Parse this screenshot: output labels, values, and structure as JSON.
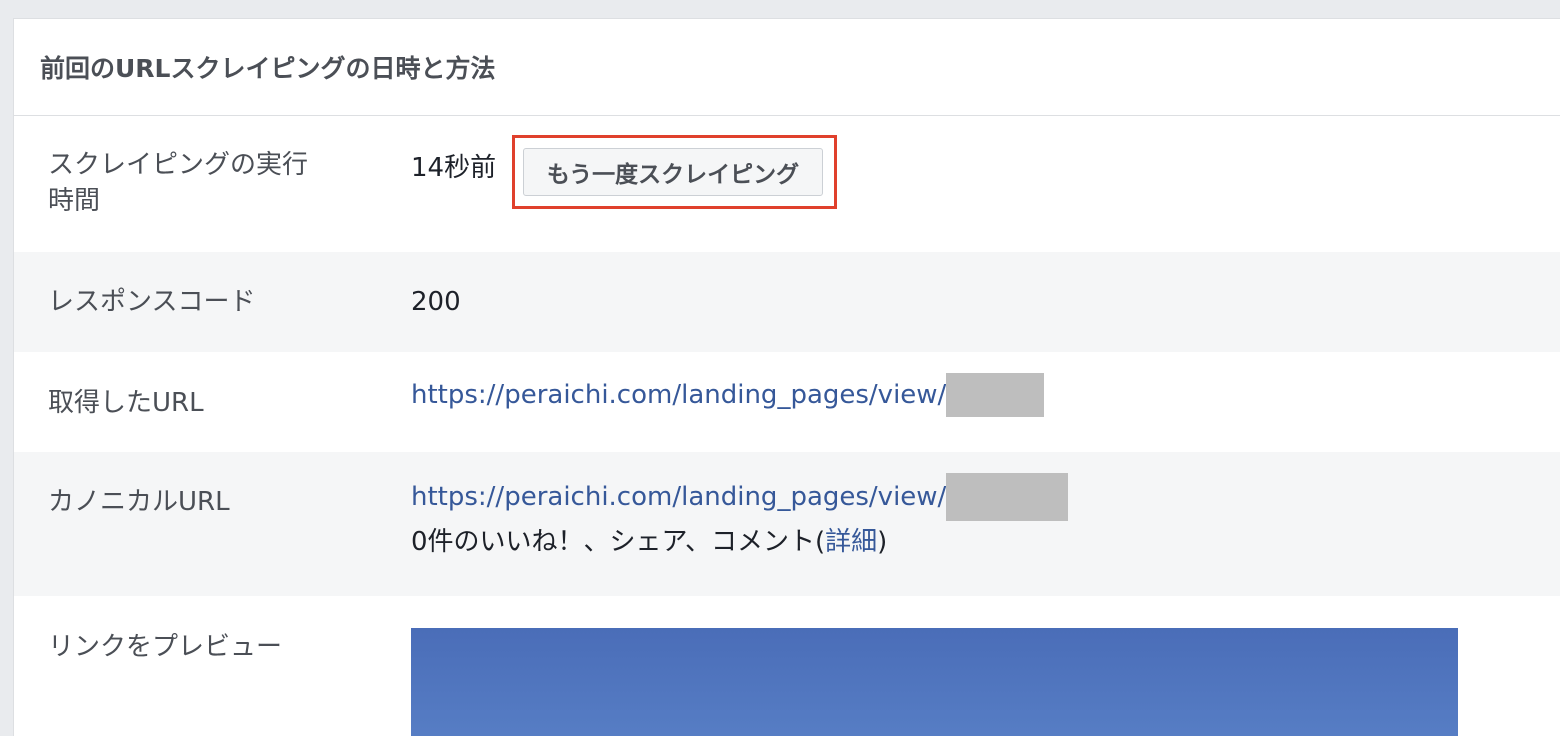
{
  "header": {
    "title": "前回のURLスクレイピングの日時と方法"
  },
  "rows": {
    "scrape_time": {
      "label_line1": "スクレイピングの実行",
      "label_line2": "時間",
      "value": "14秒前",
      "rescrape_button": "もう一度スクレイピング"
    },
    "response_code": {
      "label": "レスポンスコード",
      "value": "200"
    },
    "fetched_url": {
      "label": "取得したURL",
      "value": "https://peraichi.com/landing_pages/view/"
    },
    "canonical_url": {
      "label": "カノニカルURL",
      "value": "https://peraichi.com/landing_pages/view/",
      "stats_text": "0件のいいね！、シェア、コメント(",
      "details_link": "詳細",
      "stats_close": ")"
    },
    "link_preview": {
      "label": "リンクをプレビュー"
    }
  },
  "colors": {
    "link": "#365899",
    "highlight_border": "#e0402c",
    "alt_row_bg": "#f5f6f7",
    "redaction": "#bebebe"
  }
}
